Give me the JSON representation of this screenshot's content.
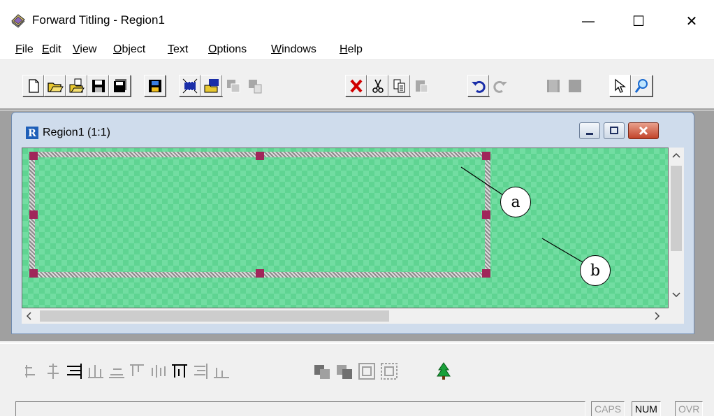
{
  "window": {
    "title": "Forward Titling - Region1",
    "controls": {
      "minimize": "—",
      "maximize": "☐",
      "close": "✕"
    }
  },
  "menu": [
    {
      "label": "File",
      "accel": "F",
      "rest": "ile"
    },
    {
      "label": "Edit",
      "accel": "E",
      "rest": "dit"
    },
    {
      "label": "View",
      "accel": "V",
      "rest": "iew"
    },
    {
      "label": "Object",
      "accel": "O",
      "rest": "bject"
    },
    {
      "label": "Text",
      "accel": "T",
      "rest": "ext"
    },
    {
      "label": "Options",
      "accel": "O",
      "rest": "ptions"
    },
    {
      "label": "Windows",
      "accel": "W",
      "rest": "indows"
    },
    {
      "label": "Help",
      "accel": "H",
      "rest": "elp"
    }
  ],
  "toolbar_icons": [
    "new-icon",
    "open-icon",
    "open-template-icon",
    "save-icon",
    "save-all-icon",
    "save-region-icon",
    "film-new-icon",
    "film-open-icon",
    "object-copy-icon",
    "object-paste-icon",
    "delete-icon",
    "cut-icon",
    "copy-icon",
    "paste-icon",
    "undo-icon",
    "redo-icon",
    "layer-1-icon",
    "layer-2-icon",
    "select-arrow-icon",
    "zoom-magnifier-icon"
  ],
  "child": {
    "title": "Region1  (1:1)",
    "icon_letter": "R"
  },
  "callouts": {
    "a": "a",
    "b": "b"
  },
  "colors": {
    "canvas": "#5fd492",
    "handle": "#a0265a",
    "mdi": "#a0a0a0"
  },
  "bottom_toolbar_icons": [
    "align-left-icon",
    "align-center-h-icon",
    "align-right-icon",
    "distribute-h-icon",
    "align-bottom-icon",
    "align-top-icon",
    "align-center-v-icon",
    "distribute-v-icon",
    "align-left-edge-icon",
    "align-right-edge-icon",
    "bring-forward-icon",
    "send-backward-icon",
    "group-icon",
    "ungroup-icon",
    "tree-icon"
  ],
  "status": {
    "caps": "CAPS",
    "num": "NUM",
    "ovr": "OVR"
  }
}
